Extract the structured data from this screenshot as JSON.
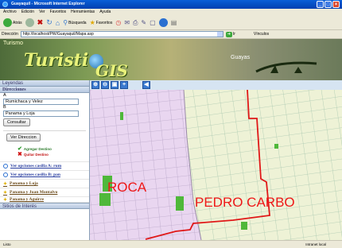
{
  "window": {
    "title": "Guayaquil - Microsoft Internet Explorer"
  },
  "menu": [
    "Archivo",
    "Edición",
    "Ver",
    "Favoritos",
    "Herramientas",
    "Ayuda"
  ],
  "toolbar": {
    "back_label": "Atrás",
    "search_label": "Búsqueda",
    "favorites_label": "Favoritos"
  },
  "address": {
    "label": "Dirección",
    "url": "http://localhost/PW/Guayaquil/Mapa.asp",
    "go_label": "Ir",
    "links_label": "Vínculos"
  },
  "banner": {
    "turismo": "Turismo",
    "logo_pre": "Turisti",
    "logo_post": "GIS",
    "guayas": "Guayas"
  },
  "sidebar": {
    "leyendas": "Leyendas",
    "direcciones": "Direcciones",
    "a_label": "A",
    "a_value": "Rumichaca y Velez",
    "b_label": "B",
    "b_value": "Panama y Loja",
    "consultar": "Consultar",
    "ver_direccion": "Ver Direccion",
    "agregar": "Agregar Destino",
    "quitar": "Quitar Destino",
    "options_a": "Ver opciones casilla A: rum",
    "options_b": "Ver opciones casilla B: pan",
    "results": [
      "Panama y Loja",
      "Panama y Juan Montalvo",
      "Panama y Aguirre"
    ],
    "sitios": "Sitios de Interés"
  },
  "map": {
    "label_roca": "ROCA",
    "label_pedro": "PEDRO CARBO"
  },
  "status": {
    "left": "Listo",
    "right": "Intranet local"
  }
}
